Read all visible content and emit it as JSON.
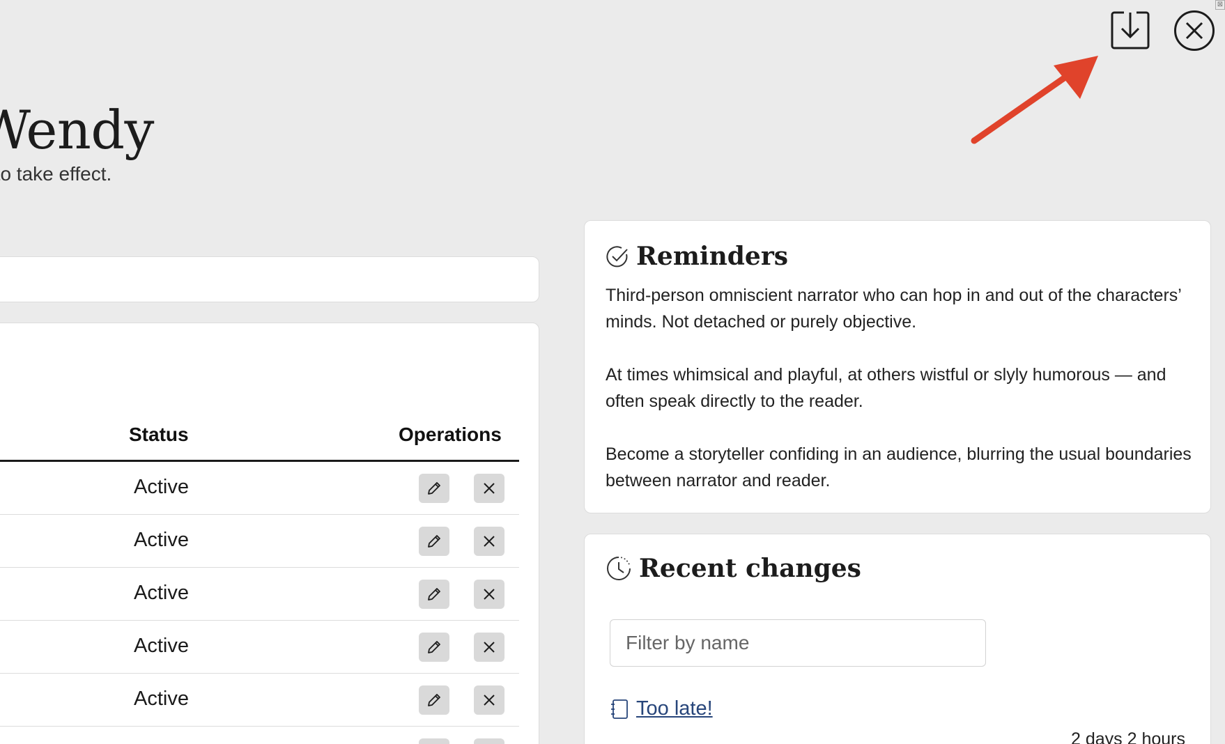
{
  "header": {
    "title": "Wendy",
    "subtitle": "em to take effect.",
    "corner_mark": "⊠"
  },
  "table": {
    "columns": {
      "status": "Status",
      "operations": "Operations"
    },
    "rows": [
      {
        "status": "Active"
      },
      {
        "status": "Active"
      },
      {
        "status": "Active"
      },
      {
        "status": "Active"
      },
      {
        "status": "Active"
      }
    ]
  },
  "reminders": {
    "title": "Reminders",
    "icon": "check-circle-icon",
    "paragraphs": [
      "Third-person omniscient narrator who can hop in and out of the characters’ minds. Not detached or purely objective.",
      "At times whimsical and playful, at others wistful or slyly humorous — and often speak directly to the reader.",
      "Become a storyteller confiding in an audience, blurring the usual boundaries between narrator and reader."
    ]
  },
  "recent_changes": {
    "title": "Recent changes",
    "icon": "clock-icon",
    "filter_placeholder": "Filter by name",
    "items": [
      {
        "label": "Too late!",
        "time": "2 days 2 hours"
      }
    ]
  },
  "colors": {
    "background": "#ebebeb",
    "card": "#ffffff",
    "annotation_arrow": "#e0432b",
    "link": "#27457a",
    "op_button": "#d9d9d9"
  }
}
